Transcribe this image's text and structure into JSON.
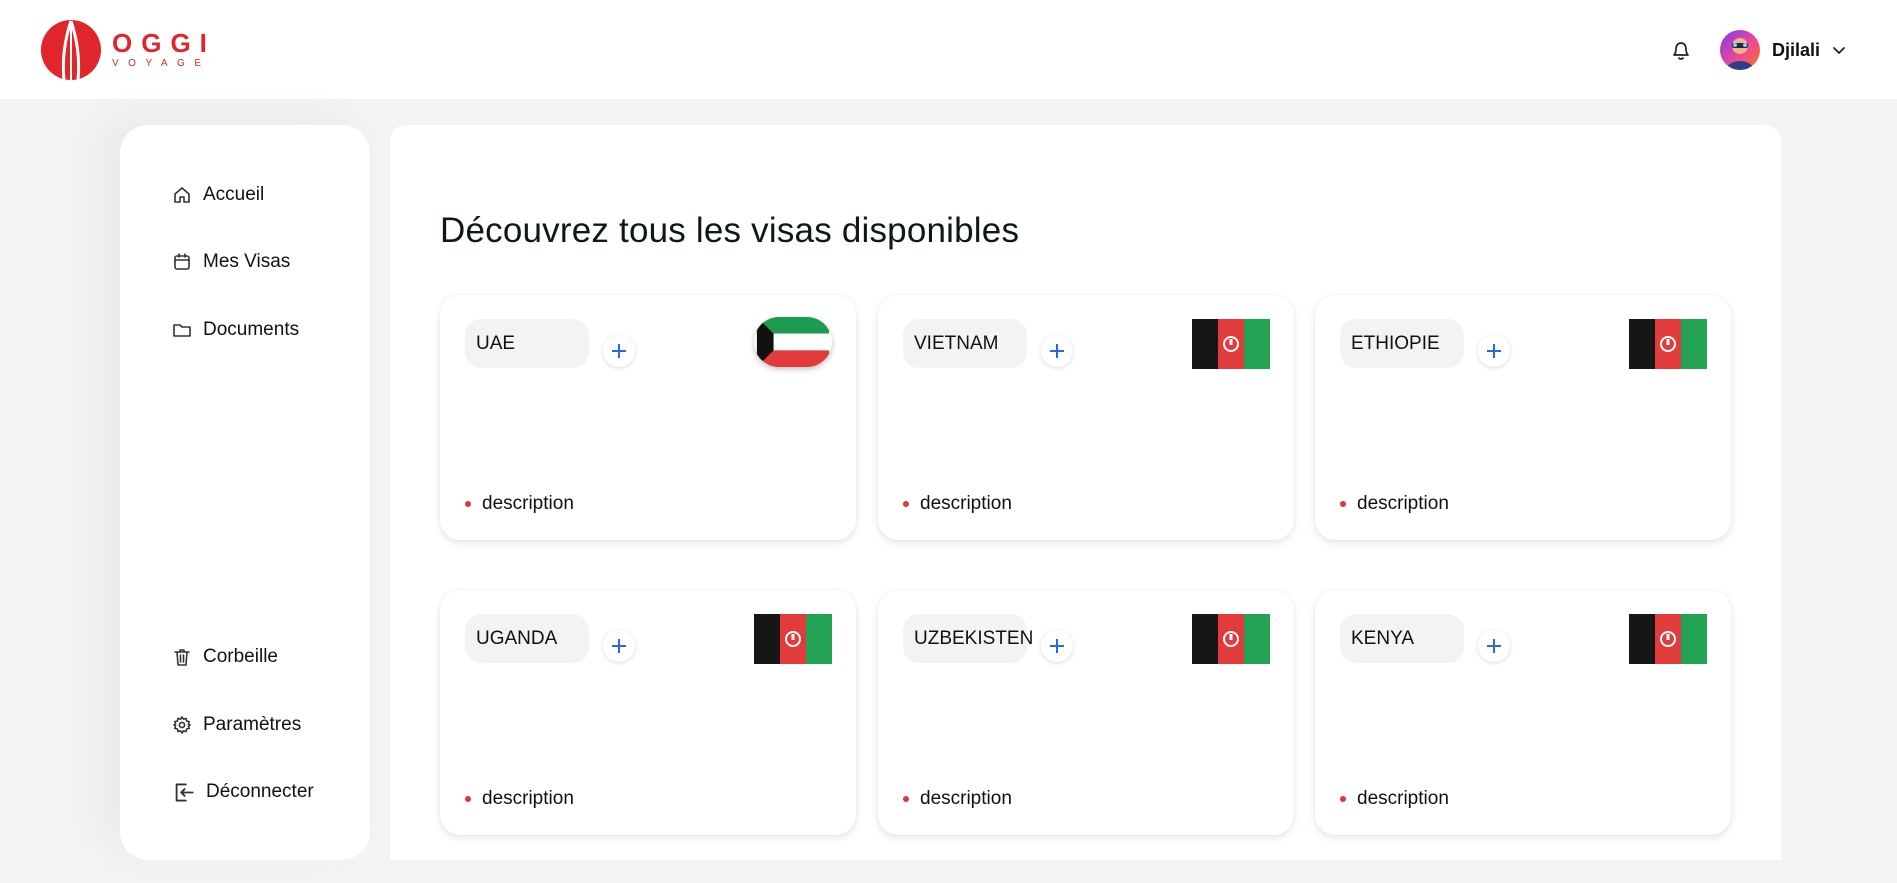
{
  "brand": {
    "name": "OGGI",
    "tagline": "VOYAGE",
    "accent": "#e0262b"
  },
  "header": {
    "user_name": "Djilali"
  },
  "sidebar": {
    "top_items": [
      {
        "label": "Accueil",
        "icon": "home-icon"
      },
      {
        "label": "Mes Visas",
        "icon": "calendar-icon"
      },
      {
        "label": "Documents",
        "icon": "folder-icon"
      }
    ],
    "bottom_items": [
      {
        "label": "Corbeille",
        "icon": "trash-icon"
      },
      {
        "label": "Paramètres",
        "icon": "gear-icon"
      },
      {
        "label": "Déconnecter",
        "icon": "logout-icon"
      }
    ]
  },
  "main": {
    "title": "Découvrez tous les visas disponibles",
    "cards": [
      {
        "country": "UAE",
        "flag": "kuwait-flag-icon",
        "description": "description"
      },
      {
        "country": "VIETNAM",
        "flag": "afghanistan-flag-icon",
        "description": "description"
      },
      {
        "country": "ETHIOPIE",
        "flag": "afghanistan-flag-icon",
        "description": "description"
      },
      {
        "country": "UGANDA",
        "flag": "afghanistan-flag-icon",
        "description": "description"
      },
      {
        "country": "UZBEKISTEN",
        "flag": "afghanistan-flag-icon",
        "description": "description"
      },
      {
        "country": "KENYA",
        "flag": "afghanistan-flag-icon",
        "description": "description"
      }
    ]
  },
  "colors": {
    "plus_icon": "#2a66e6",
    "bullet": "#e0353a",
    "page_bg": "#f3f3f3"
  }
}
